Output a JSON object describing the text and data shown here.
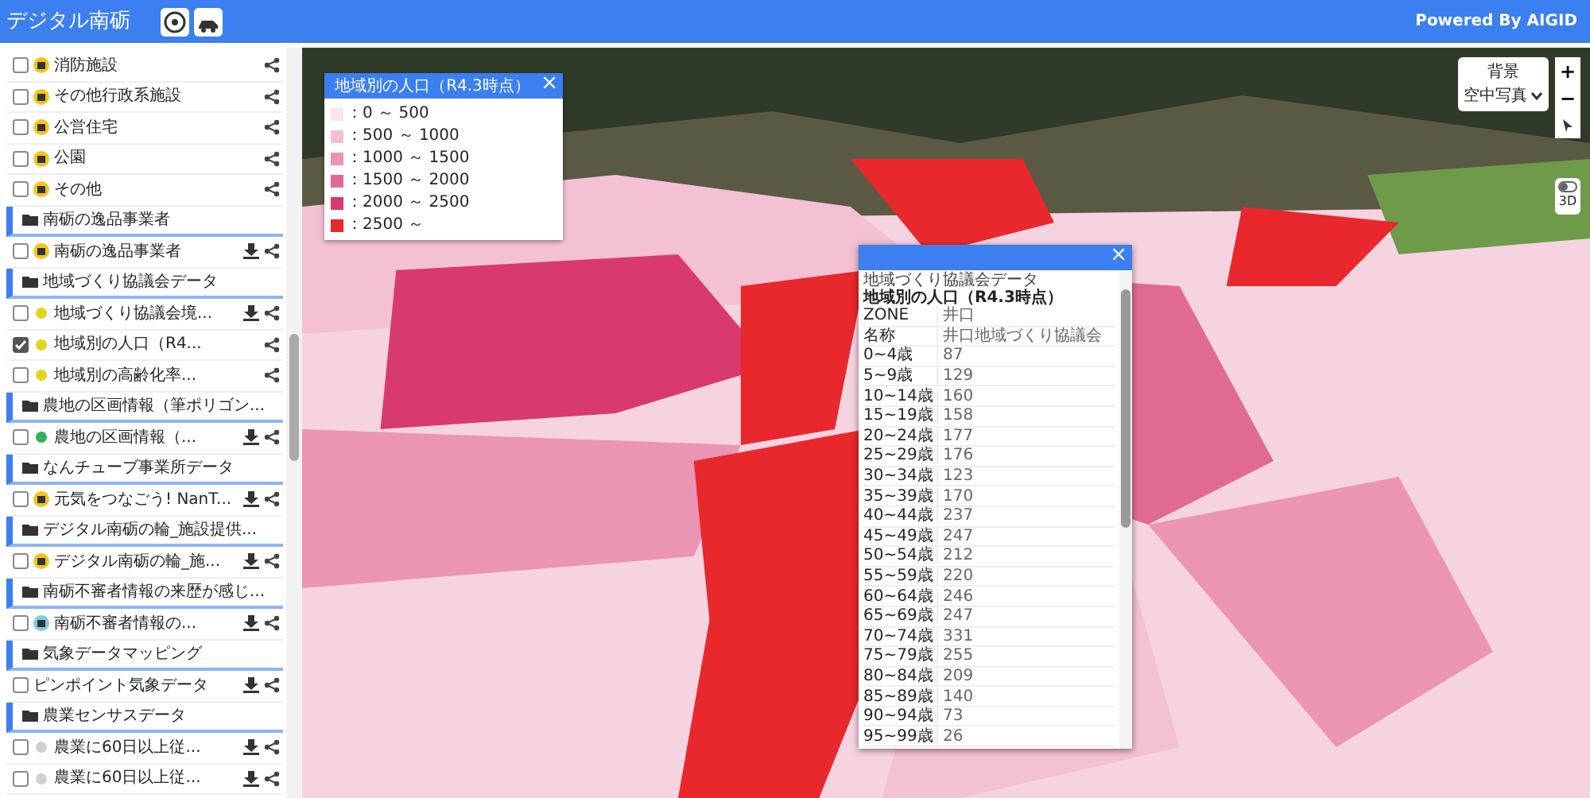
{
  "header": {
    "title": "デジタル南砺",
    "powered_by": "Powered By AIGID"
  },
  "sidebar": {
    "items": [
      {
        "kind": "layer",
        "label": "消防施設",
        "checked": false,
        "download": false,
        "marker": {
          "kind": "badge",
          "color": "#f5c518"
        }
      },
      {
        "kind": "layer",
        "label": "その他行政系施設",
        "checked": false,
        "download": false,
        "marker": {
          "kind": "badge",
          "color": "#f5c518"
        }
      },
      {
        "kind": "layer",
        "label": "公営住宅",
        "checked": false,
        "download": false,
        "marker": {
          "kind": "badge",
          "color": "#f5c518"
        }
      },
      {
        "kind": "layer",
        "label": "公園",
        "checked": false,
        "download": false,
        "marker": {
          "kind": "badge",
          "color": "#f5c518"
        }
      },
      {
        "kind": "layer",
        "label": "その他",
        "checked": false,
        "download": false,
        "marker": {
          "kind": "badge",
          "color": "#f5c518"
        }
      },
      {
        "kind": "group",
        "label": "南砺の逸品事業者"
      },
      {
        "kind": "layer",
        "label": "南砺の逸品事業者",
        "checked": false,
        "download": true,
        "marker": {
          "kind": "badge",
          "color": "#f5c518"
        }
      },
      {
        "kind": "group",
        "label": "地域づくり協議会データ"
      },
      {
        "kind": "layer",
        "label": "地域づくり協議会境...",
        "checked": false,
        "download": true,
        "marker": {
          "kind": "dot",
          "color": "#e6d21e"
        }
      },
      {
        "kind": "layer",
        "label": "地域別の人口（R4...",
        "checked": true,
        "download": false,
        "marker": {
          "kind": "dot",
          "color": "#e6d21e"
        }
      },
      {
        "kind": "layer",
        "label": "地域別の高齢化率...",
        "checked": false,
        "download": false,
        "marker": {
          "kind": "dot",
          "color": "#e6d21e"
        }
      },
      {
        "kind": "group",
        "label": "農地の区画情報（筆ポリゴン..."
      },
      {
        "kind": "layer",
        "label": "農地の区画情報（...",
        "checked": false,
        "download": true,
        "marker": {
          "kind": "dot",
          "color": "#2fb45a"
        }
      },
      {
        "kind": "group",
        "label": "なんチューブ事業所データ"
      },
      {
        "kind": "layer",
        "label": "元気をつなごう! NanT...",
        "checked": false,
        "download": true,
        "marker": {
          "kind": "badge",
          "color": "#f5c518"
        }
      },
      {
        "kind": "group",
        "label": "デジタル南砺の輪_施設提供..."
      },
      {
        "kind": "layer",
        "label": "デジタル南砺の輪_施...",
        "checked": false,
        "download": true,
        "marker": {
          "kind": "badge",
          "color": "#f5c518"
        }
      },
      {
        "kind": "group",
        "label": "南砺不審者情報の来歴が感じ..."
      },
      {
        "kind": "layer",
        "label": "南砺不審者情報の...",
        "checked": false,
        "download": true,
        "marker": {
          "kind": "badge",
          "color": "#7fc8f0"
        }
      },
      {
        "kind": "group",
        "label": "気象データマッピング"
      },
      {
        "kind": "layer",
        "label": "ピンポイント気象データ",
        "checked": false,
        "download": true,
        "marker": null
      },
      {
        "kind": "group",
        "label": "農業センサスデータ"
      },
      {
        "kind": "layer",
        "label": "農業に60日以上従...",
        "checked": false,
        "download": true,
        "marker": {
          "kind": "dot",
          "color": "#d0d0d0"
        }
      },
      {
        "kind": "layer",
        "label": "農業に60日以上従...",
        "checked": false,
        "download": true,
        "marker": {
          "kind": "dot",
          "color": "#d0d0d0"
        }
      }
    ]
  },
  "legend": {
    "title": "地域別の人口（R4.3時点）",
    "close": "×",
    "entries": [
      {
        "label": "：0 ～ 500",
        "color": "#fbe3ec"
      },
      {
        "label": "：500 ～ 1000",
        "color": "#f4bfd2"
      },
      {
        "label": "：1000 ～ 1500",
        "color": "#ec94b4"
      },
      {
        "label": "：1500 ～ 2000",
        "color": "#e16a95"
      },
      {
        "label": "：2000 ～ 2500",
        "color": "#d93a6e"
      },
      {
        "label": "：2500 ～",
        "color": "#e8282c"
      }
    ]
  },
  "popup": {
    "close": "×",
    "subtitle": "地域づくり協議会データ",
    "title": "地域別の人口（R4.3時点）",
    "rows": [
      [
        "ZONE",
        "井口"
      ],
      [
        "名称",
        "井口地域づくり協議会"
      ],
      [
        "0~4歳",
        "87"
      ],
      [
        "5~9歳",
        "129"
      ],
      [
        "10~14歳",
        "160"
      ],
      [
        "15~19歳",
        "158"
      ],
      [
        "20~24歳",
        "177"
      ],
      [
        "25~29歳",
        "176"
      ],
      [
        "30~34歳",
        "123"
      ],
      [
        "35~39歳",
        "170"
      ],
      [
        "40~44歳",
        "237"
      ],
      [
        "45~49歳",
        "247"
      ],
      [
        "50~54歳",
        "212"
      ],
      [
        "55~59歳",
        "220"
      ],
      [
        "60~64歳",
        "246"
      ],
      [
        "65~69歳",
        "247"
      ],
      [
        "70~74歳",
        "331"
      ],
      [
        "75~79歳",
        "255"
      ],
      [
        "80~84歳",
        "209"
      ],
      [
        "85~89歳",
        "140"
      ],
      [
        "90~94歳",
        "73"
      ],
      [
        "95~99歳",
        "26"
      ]
    ]
  },
  "map_controls": {
    "background_label": "背景",
    "background_value": "空中写真",
    "zoom_in": "+",
    "zoom_out": "−",
    "toggle_3d": {
      "label": "3D",
      "on": false
    }
  }
}
